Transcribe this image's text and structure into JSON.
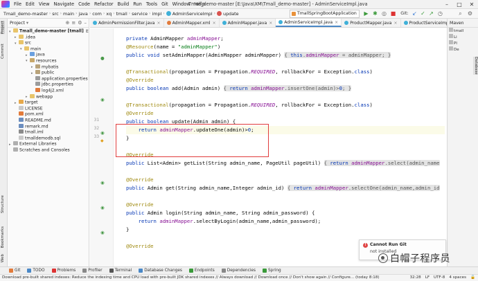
{
  "titlebar": {
    "menu": [
      "File",
      "Edit",
      "View",
      "Navigate",
      "Code",
      "Refactor",
      "Build",
      "Run",
      "Tools",
      "Git",
      "Window",
      "Help"
    ],
    "window_title": "Tmall_demo-master [E:\\Java\\XM\\Tmall_demo-master] - AdminServiceImpl.java"
  },
  "navbar": {
    "breadcrumbs": [
      "Tmall_demo-master",
      "src",
      "main",
      "java",
      "com",
      "xq",
      "tmall",
      "service",
      "impl",
      "AdminServiceImpl",
      "update"
    ],
    "run_config": "TmallSpringBootApplication",
    "git_label": "Git:"
  },
  "left_stripe": {
    "tabs": [
      "Project",
      "Commit",
      "Structure",
      "Bookmarks",
      "Web"
    ]
  },
  "project": {
    "header": "Project",
    "tree": [
      {
        "label": "Tmall_demo-master [tmall]",
        "suffix": "E:\\Java\\",
        "icon": "folder",
        "indent": 0,
        "arrow": "▾"
      },
      {
        "label": ".idea",
        "icon": "folder",
        "indent": 1,
        "arrow": "▸"
      },
      {
        "label": "src",
        "icon": "folder",
        "indent": 1,
        "arrow": "▾"
      },
      {
        "label": "main",
        "icon": "folder",
        "indent": 2,
        "arrow": "▾"
      },
      {
        "label": "java",
        "icon": "src",
        "indent": 3,
        "arrow": "▸"
      },
      {
        "label": "resources",
        "icon": "res",
        "indent": 3,
        "arrow": "▾"
      },
      {
        "label": "mybatis",
        "icon": "pkg",
        "indent": 4,
        "arrow": "▸"
      },
      {
        "label": "public",
        "icon": "pkg",
        "indent": 4,
        "arrow": "▸"
      },
      {
        "label": "application.properties",
        "icon": "props",
        "indent": 4,
        "arrow": ""
      },
      {
        "label": "jdbc.properties",
        "icon": "props",
        "indent": 4,
        "arrow": ""
      },
      {
        "label": "log4j2.xml",
        "icon": "xml",
        "indent": 4,
        "arrow": ""
      },
      {
        "label": "webapp",
        "icon": "folder",
        "indent": 3,
        "arrow": "▸"
      },
      {
        "label": "target",
        "icon": "target",
        "indent": 1,
        "arrow": "▸"
      },
      {
        "label": "LICENSE",
        "icon": "file",
        "indent": 1,
        "arrow": ""
      },
      {
        "label": "pom.xml",
        "icon": "xml",
        "indent": 1,
        "arrow": ""
      },
      {
        "label": "README.md",
        "icon": "md",
        "indent": 1,
        "arrow": ""
      },
      {
        "label": "remark.md",
        "icon": "md",
        "indent": 1,
        "arrow": ""
      },
      {
        "label": "tmall.iml",
        "icon": "iml",
        "indent": 1,
        "arrow": ""
      },
      {
        "label": "tmalldemodb.sql",
        "icon": "file",
        "indent": 1,
        "arrow": ""
      },
      {
        "label": "External Libraries",
        "icon": "lib",
        "indent": 0,
        "arrow": "▸"
      },
      {
        "label": "Scratches and Consoles",
        "icon": "lib",
        "indent": 0,
        "arrow": ""
      }
    ]
  },
  "editor_tabs": [
    {
      "label": "AdminPermissionFilter.java",
      "active": false
    },
    {
      "label": "AdminMapper.xml",
      "active": false
    },
    {
      "label": "AdminMapper.java",
      "active": false
    },
    {
      "label": "AdminServiceImpl.java",
      "active": true
    },
    {
      "label": "ProductMapper.java",
      "active": false
    },
    {
      "label": "ProductServiceImpl.java",
      "active": false
    }
  ],
  "gutter": {
    "line_numbers": [
      {
        "n": "31",
        "row": 10
      },
      {
        "n": "32",
        "row": 11
      },
      {
        "n": "33",
        "row": 12
      }
    ]
  },
  "code_lines": [
    "<span class=\"kw\">private</span> AdminMapper <span class=\"fld\">adminMapper</span>;",
    "<span class=\"an\">@Resource</span>(name = <span class=\"str\">\"adminMapper\"</span>)",
    "<span class=\"kw\">public void</span> setAdminMapper(AdminMapper adminMapper) <span class=\"fold\">{ <span class=\"kw\">this</span>.<span class=\"fld\">adminMapper</span> = adminMapper; }</span>",
    "",
    "<span class=\"an\">@Transactional</span>(propagation = Propagation.<span class=\"it\">REQUIRED</span>, rollbackFor = Exception.<span class=\"kw\">class</span>)",
    "<span class=\"an\">@Override</span>",
    "<span class=\"kw\">public boolean</span> add(Admin admin) <span class=\"fold\">{ <span class=\"kw\">return</span> <span class=\"fld\">adminMapper</span>.insertOne(admin)&gt;<span class=\"kw\">0</span>; }</span>",
    "",
    "<span class=\"an\">@Transactional</span>(propagation = Propagation.<span class=\"it\">REQUIRED</span>, rollbackFor = Exception.<span class=\"kw\">class</span>)",
    "<span class=\"an\">@Override</span>",
    "<span class=\"kw\">public boolean</span> update(Admin admin) {",
    "    <span class=\"kw\">return</span> <span class=\"fld\">adminMapper</span>.updateOne(admin)&gt;<span class=\"kw\">0</span>;",
    "}",
    "",
    "<span class=\"an\">@Override</span>",
    "<span class=\"kw\">public</span> List&lt;Admin&gt; getList(String admin_name, PageUtil pageUtil) <span class=\"fold\">{ <span class=\"kw\">return</span> <span class=\"fld\">adminMapper</span>.select(admin_name</span>",
    "",
    "<span class=\"an\">@Override</span>",
    "<span class=\"kw\">public</span> Admin get(String admin_name,Integer admin_id) <span class=\"fold\">{ <span class=\"kw\">return</span> <span class=\"fld\">adminMapper</span>.selectOne(admin_name,admin_id</span>",
    "",
    "<span class=\"an\">@Override</span>",
    "<span class=\"kw\">public</span> Admin login(String admin_name, String admin_password) {",
    "    <span class=\"kw\">return</span> <span class=\"fld\">adminMapper</span>.selectByLogin(admin_name,admin_password);",
    "}",
    "",
    "<span class=\"an\">@Override</span>"
  ],
  "right_panel": {
    "header": "Maven",
    "items": [
      "tmall",
      "Li",
      "Pl",
      "De"
    ],
    "vtab": "Database"
  },
  "notification": {
    "title": "Cannot Run Git",
    "body": "not installed"
  },
  "watermark": {
    "text": "白帽子程序员"
  },
  "bottom_tabs": [
    "Git",
    "TODO",
    "Problems",
    "Profiler",
    "Terminal",
    "Database Changes",
    "Endpoints",
    "Dependencies",
    "Spring"
  ],
  "status": {
    "message": "Download pre-built shared indexes: Reduce the indexing time and CPU load with pre-built JDK shared indexes // Always download // Download once // Don't show again // Configure... (today 8:18)",
    "position": "32:28",
    "line_sep": "LF",
    "encoding": "UTF-8",
    "indent": "4 spaces"
  },
  "colors": {
    "highlight_box": "#e03c3c",
    "keyword": "#0033b3",
    "annotation": "#9e880d",
    "string": "#067d17",
    "field": "#871094"
  }
}
